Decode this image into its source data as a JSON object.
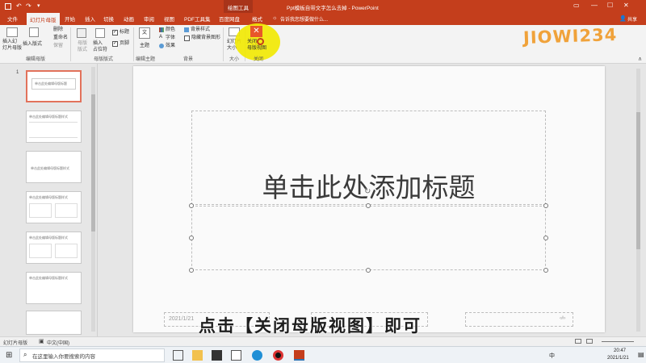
{
  "app": {
    "context_tab_title": "绘图工具",
    "window_title": "Ppt模板自带文字怎么去掉 - PowerPoint",
    "share_label": "共享",
    "tell_me": "告诉我您想要做什么...",
    "watermark": "JIOWI234"
  },
  "tabs": [
    "文件",
    "幻灯片母版",
    "开始",
    "插入",
    "切换",
    "动画",
    "审阅",
    "视图",
    "PDF工具集",
    "百度网盘",
    "格式"
  ],
  "ribbon": {
    "insert_slide_master": "插入幻\n灯片母版",
    "insert_layout": "插入版式",
    "delete": "删除",
    "rename": "重命名",
    "preserve": "保留",
    "edit_master_group": "编辑母版",
    "master_layout": "母版\n版式",
    "insert_placeholder": "插入\n占位符",
    "title_cb": "标题",
    "footer_cb": "页脚",
    "master_layout_group": "母版版式",
    "theme": "主题",
    "edit_theme_group": "编辑主题",
    "colors": "颜色",
    "fonts": "字体",
    "effects": "效果",
    "bg_styles": "背景样式",
    "hide_bg": "隐藏背景图形",
    "background_group": "背景",
    "slide_size": "幻灯片\n大小",
    "size_group": "大小",
    "close_master": "关闭\n母版视图",
    "close_group": "关闭"
  },
  "slide": {
    "title_placeholder": "单击此处添加标题",
    "date": "2021/1/21",
    "page_num": "‹#›"
  },
  "thumbnail_titles": [
    "单击此处编辑母版标题",
    "单击此处编辑母版标题样式",
    "单击此处编辑母版标题样式",
    "单击此处编辑母版标题样式",
    "单击此处编辑母版标题样式",
    "单击此处编辑母版标题样式",
    ""
  ],
  "subtitle_caption": "点击【关闭母版视图】即可",
  "status": {
    "view": "幻灯片母版",
    "language": "中文(中国)"
  },
  "taskbar": {
    "search_placeholder": "在这里输入你要搜索的内容",
    "ime": "中",
    "time": "20:47",
    "date": "2021/1/21"
  },
  "colors": {
    "ppt_red": "#c43e1c",
    "highlight": "#f2e900",
    "close_icon": "#e8562a"
  }
}
